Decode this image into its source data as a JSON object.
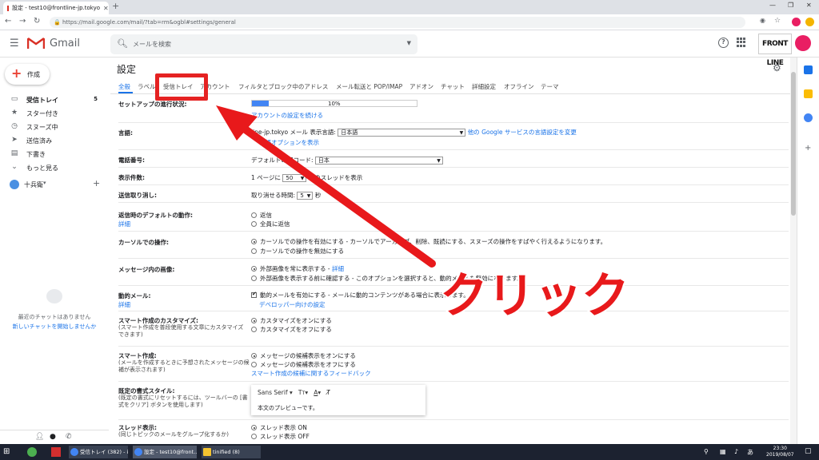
{
  "browser": {
    "tab_title": "設定 - test10@frontline-jp.tokyo",
    "url": "https://mail.google.com/mail/?tab=rm&ogbl#settings/general"
  },
  "gmail": {
    "brand": "Gmail",
    "search_placeholder": "メールを検索",
    "org_logo": "FRONT LINE"
  },
  "sidebar": {
    "compose": "作成",
    "items": [
      {
        "label": "受信トレイ",
        "count": "5",
        "icon": "inbox-icon"
      },
      {
        "label": "スター付き",
        "icon": "star-icon"
      },
      {
        "label": "スヌーズ中",
        "icon": "clock-icon"
      },
      {
        "label": "送信済み",
        "icon": "send-icon"
      },
      {
        "label": "下書き",
        "icon": "draft-icon"
      },
      {
        "label": "もっと見る",
        "icon": "chevron-down-icon"
      }
    ],
    "user": "十兵衛",
    "chat_none": "最近のチャットはありません",
    "chat_start": "新しいチャットを開始しませんか"
  },
  "settings": {
    "title": "設定",
    "tabs": [
      "全般",
      "ラベル",
      "受信トレイ",
      "アカウント",
      "フィルタとブロック中のアドレス",
      "メール転送と POP/IMAP",
      "アドオン",
      "チャット",
      "詳細設定",
      "オフライン",
      "テーマ"
    ],
    "active_tab": "全般",
    "setup": {
      "label": "セットアップの進行状況:",
      "progress": 0.1,
      "pct": "10%",
      "link": "アカウントの設定を続ける"
    },
    "language": {
      "label": "言語:",
      "prefix": "line-jp.tokyo メール 表示言語:",
      "value": "日本語",
      "link": "他の Google サービスの言語設定を変更",
      "link2": "言語オプションを表示"
    },
    "phone": {
      "label": "電話番号:",
      "prefix": "デフォルトの国コード:",
      "value": "日本"
    },
    "page_size": {
      "label": "表示件数:",
      "prefix": "1 ページに",
      "value": "50",
      "suffix": "件のスレッドを表示"
    },
    "undo": {
      "label": "送信取り消し:",
      "prefix": "取り消せる時間:",
      "value": "5",
      "suffix": "秒"
    },
    "reply": {
      "label": "返信時のデフォルトの動作:",
      "link": "詳細",
      "opt1": "返信",
      "opt2": "全員に返信"
    },
    "hover": {
      "label": "カーソルでの操作:",
      "opt1": "カーソルでの操作を有効にする",
      "opt1_desc": " - カーソルでアーカイブ、削除、既読にする、スヌーズの操作をすばやく行えるようになります。",
      "opt2": "カーソルでの操作を無効にする"
    },
    "images": {
      "label": "メッセージ内の画像:",
      "opt1": "外部画像を常に表示する",
      "opt1_link": "詳細",
      "opt2": "外部画像を表示する前に確認する",
      "opt2_desc": " - このオプションを選択すると、動的メールも無効になります。"
    },
    "dynamic": {
      "label": "動的メール:",
      "link": "詳細",
      "opt": "動的メールを有効にする",
      "opt_desc": " - メールに動的コンテンツがある場合に表示します。",
      "dev_link": "デベロッパー向けの設定"
    },
    "smart_custom": {
      "label": "スマート作成のカスタマイズ:",
      "sub": "(スマート作成を普段使用する文章にカスタマイズできます)",
      "opt1": "カスタマイズをオンにする",
      "opt2": "カスタマイズをオフにする"
    },
    "smart_compose": {
      "label": "スマート作成:",
      "sub": "(メールを作成するときに予想されたメッセージの候補が表示されます)",
      "opt1": "メッセージの候補表示をオンにする",
      "opt2": "メッセージの候補表示をオフにする",
      "link": "スマート作成の候補に関するフィードバック"
    },
    "text_style": {
      "label": "既定の書式スタイル:",
      "sub": "(既定の書式にリセットするには、ツールバーの [書式をクリア] ボタンを使用します)",
      "font": "Sans Serif",
      "preview": "本文のプレビューです。"
    },
    "threads": {
      "label": "スレッド表示:",
      "sub": "(同じトピックのメールをグループ化するか)",
      "opt1": "スレッド表示 ON",
      "opt2": "スレッド表示 OFF"
    }
  },
  "overlay": {
    "text": "クリック"
  },
  "taskbar": {
    "items": [
      "受信トレイ (382) - in...",
      "設定 - test10@front...",
      "tinified (8)"
    ],
    "time": "23:30",
    "date": "2019/08/07"
  }
}
